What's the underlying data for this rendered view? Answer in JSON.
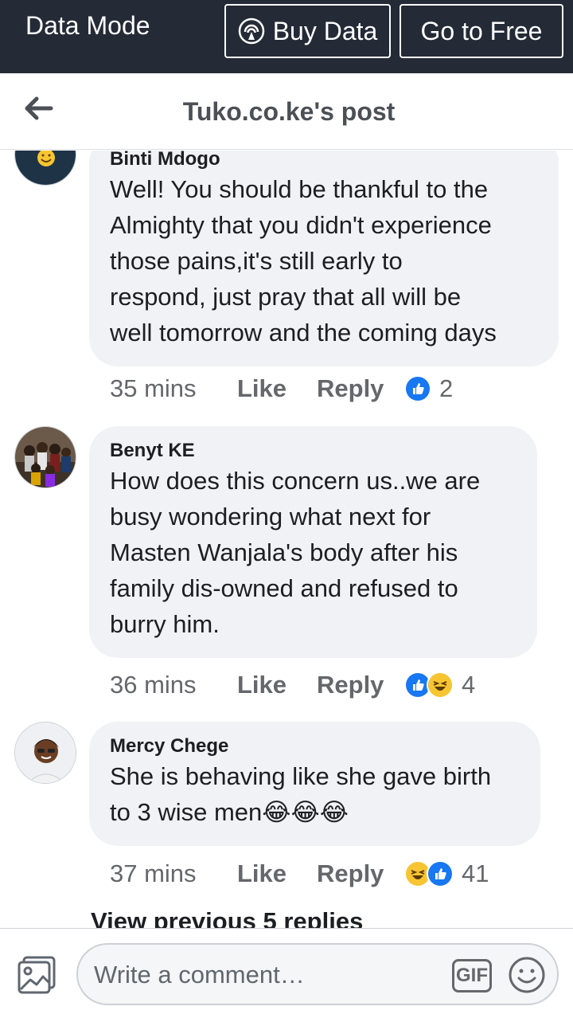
{
  "databar": {
    "mode_label": "Data Mode",
    "buy_label": "Buy Data",
    "free_label": "Go to Free",
    "bg_color": "#242a36"
  },
  "header": {
    "title": "Tuko.co.ke's post",
    "back_icon": "arrow-left-icon"
  },
  "comments": [
    {
      "name": "Binti Mdogo",
      "text": "Well! You should be thankful to the\nAlmighty that you didn't experience\nthose pains,it's still early to\nrespond, just pray that all will be\nwell tomorrow and the coming days",
      "time": "35 mins",
      "like": "Like",
      "reply": "Reply",
      "reactions": [
        "like"
      ],
      "count": "2"
    },
    {
      "name": "Benyt KE",
      "text": "How does this concern us..we are\nbusy wondering what next for\nMasten Wanjala's body after his\nfamily dis-owned and refused to\nburry him.",
      "time": "36 mins",
      "like": "Like",
      "reply": "Reply",
      "reactions": [
        "like",
        "haha"
      ],
      "count": "4"
    },
    {
      "name": "Mercy Chege",
      "text": "She is behaving like she gave birth\nto 3 wise men😂😂😂",
      "time": "37 mins",
      "like": "Like",
      "reply": "Reply",
      "reactions": [
        "haha",
        "like"
      ],
      "count": "41"
    }
  ],
  "view_previous": "View previous 5 replies",
  "composer": {
    "placeholder": "Write a comment…",
    "gif_label": "GIF"
  }
}
